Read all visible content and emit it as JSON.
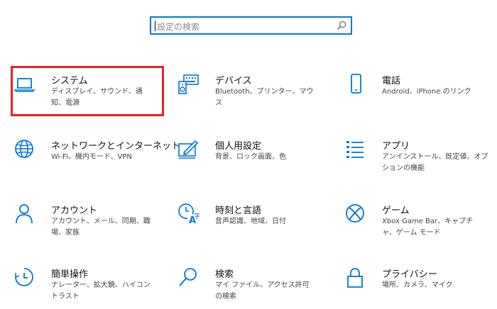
{
  "search": {
    "placeholder": "設定の検索"
  },
  "tiles": [
    {
      "title": "システム",
      "desc": "ディスプレイ、サウンド、通知、電源",
      "icon": "laptop-icon"
    },
    {
      "title": "デバイス",
      "desc": "Bluetooth、プリンター、マウス",
      "icon": "keyboard-speaker-icon"
    },
    {
      "title": "電話",
      "desc": "Android、iPhone のリンク",
      "icon": "phone-icon"
    },
    {
      "title": "ネットワークとインターネット",
      "desc": "Wi-Fi、機内モード、VPN",
      "icon": "globe-icon"
    },
    {
      "title": "個人用設定",
      "desc": "背景、ロック画面、色",
      "icon": "paint-pen-icon"
    },
    {
      "title": "アプリ",
      "desc": "アンインストール、既定値、オプションの機能",
      "icon": "apps-list-icon"
    },
    {
      "title": "アカウント",
      "desc": "アカウント、メール、同期、職場、家族",
      "icon": "person-icon"
    },
    {
      "title": "時刻と言語",
      "desc": "音声認識、地域、日付",
      "icon": "time-language-icon"
    },
    {
      "title": "ゲーム",
      "desc": "Xbox Game Bar、キャプチャ、ゲーム モード",
      "icon": "xbox-icon"
    },
    {
      "title": "簡単操作",
      "desc": "ナレーター、拡大鏡、ハイコントラスト",
      "icon": "ease-of-access-icon"
    },
    {
      "title": "検索",
      "desc": "マイ ファイル、アクセス許可の検索",
      "icon": "magnifier-icon"
    },
    {
      "title": "プライバシー",
      "desc": "場所、カメラ、マイク",
      "icon": "lock-icon"
    }
  ],
  "colors": {
    "accent": "#0078d7",
    "highlight": "#e4222a"
  }
}
